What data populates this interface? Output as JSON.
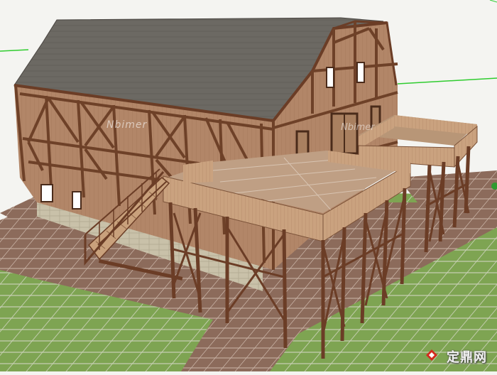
{
  "scene": {
    "watermark_main": "Nbimer",
    "watermark_side": "Nbimer",
    "logo_text": "定鼎网",
    "logo_icon": "diamond-logo-icon"
  },
  "colors": {
    "sky": "#f4f4f1",
    "axis_green": "#33cc33",
    "roof": "#6e6a64",
    "wall": "#b08468",
    "timber": "#6f4329",
    "deck": "#c9a27e",
    "grass": "#7aa050",
    "paving": "#8a6a5a",
    "stone": "#c8c0a8",
    "logo_red": "#d42a1e"
  }
}
